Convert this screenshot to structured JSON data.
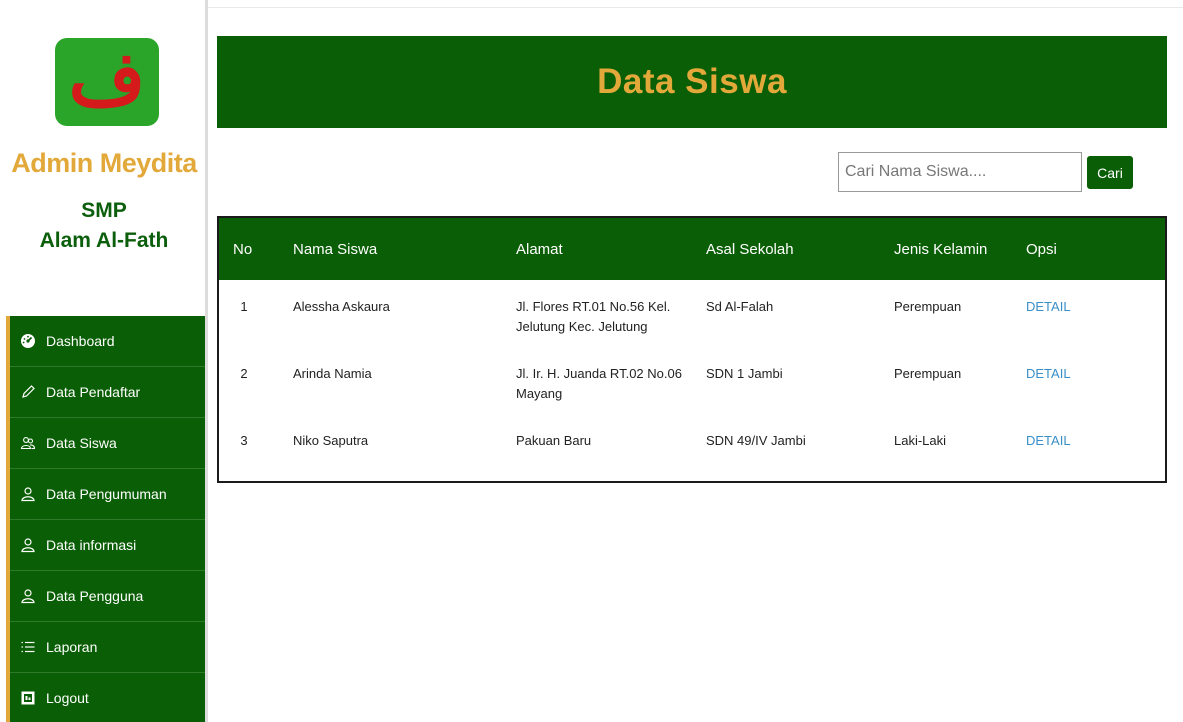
{
  "sidebar": {
    "logo_glyph": "ف",
    "admin_name": "Admin Meydita",
    "school_name": "SMP\nAlam Al-Fath",
    "items": [
      {
        "label": "Dashboard",
        "icon": "dashboard-icon"
      },
      {
        "label": "Data Pendaftar",
        "icon": "pencil-icon"
      },
      {
        "label": "Data Siswa",
        "icon": "users-icon"
      },
      {
        "label": "Data Pengumuman",
        "icon": "user-icon"
      },
      {
        "label": "Data informasi",
        "icon": "user-icon"
      },
      {
        "label": "Data Pengguna",
        "icon": "user-icon"
      },
      {
        "label": "Laporan",
        "icon": "list-icon"
      },
      {
        "label": "Logout",
        "icon": "logout-icon"
      }
    ]
  },
  "header": {
    "title": "Data Siswa"
  },
  "search": {
    "placeholder": "Cari Nama Siswa....",
    "button_label": "Cari"
  },
  "table": {
    "columns": [
      "No",
      "Nama Siswa",
      "Alamat",
      "Asal Sekolah",
      "Jenis Kelamin",
      "Opsi"
    ],
    "rows": [
      {
        "no": "1",
        "nama": "Alessha Askaura",
        "alamat": "Jl. Flores RT.01 No.56 Kel. Jelutung Kec. Jelutung",
        "asal": "Sd Al-Falah",
        "jk": "Perempuan",
        "opsi": "DETAIL"
      },
      {
        "no": "2",
        "nama": "Arinda Namia",
        "alamat": "Jl. Ir. H. Juanda RT.02 No.06 Mayang",
        "asal": "SDN 1 Jambi",
        "jk": "Perempuan",
        "opsi": "DETAIL"
      },
      {
        "no": "3",
        "nama": "Niko Saputra",
        "alamat": "Pakuan Baru",
        "asal": "SDN 49/IV Jambi",
        "jk": "Laki-Laki",
        "opsi": "DETAIL"
      }
    ]
  },
  "colors": {
    "primary_green": "#0a5e05",
    "accent_gold": "#e2a93a",
    "link_blue": "#3a8fc7"
  }
}
